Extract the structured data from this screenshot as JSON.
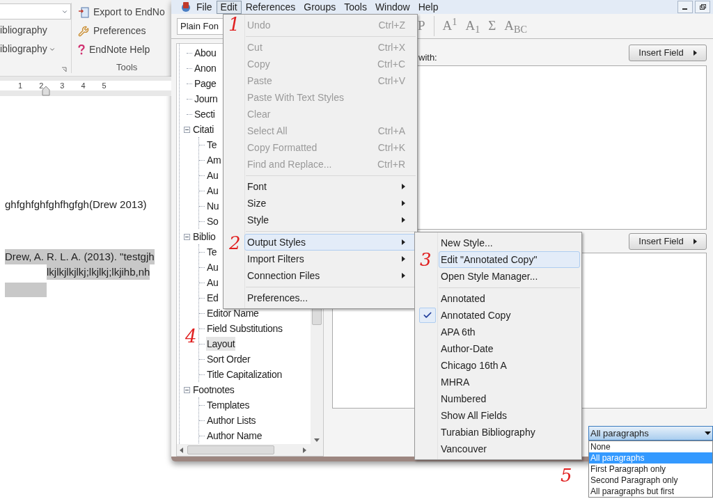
{
  "word": {
    "ribbon": {
      "left_items": [
        {
          "label": "ibliography",
          "dropdown": false
        },
        {
          "label": "ibliography",
          "dropdown": true
        }
      ],
      "tools": [
        {
          "label": "Export to EndNo"
        },
        {
          "label": "Preferences"
        },
        {
          "label": "EndNote Help"
        }
      ],
      "group_label": "Tools"
    },
    "ruler": [
      "1",
      "2",
      "3",
      "4",
      "5"
    ],
    "document": {
      "citation_text": "ghfghfghfghfhgfgh(Drew 2013)",
      "bibliography_lines": [
        "Drew, A. R. L. A. (2013). \"testgjh",
        "lkjlkjlkjlkj;lkjlkj;lkjihb,nh"
      ]
    }
  },
  "endnote": {
    "menu_bar": [
      {
        "label": "File",
        "selected": false
      },
      {
        "label": "Edit",
        "selected": true
      },
      {
        "label": "References",
        "selected": false
      },
      {
        "label": "Groups",
        "selected": false
      },
      {
        "label": "Tools",
        "selected": false
      },
      {
        "label": "Window",
        "selected": false
      },
      {
        "label": "Help",
        "selected": false
      }
    ],
    "toolbar": {
      "font_select": "Plain Fon",
      "buttons": [
        "P",
        "A$^{1}$",
        "A$_{1}$",
        "Σ",
        "A$_{BC}$"
      ]
    },
    "tree": [
      {
        "label": "Abou",
        "selected": false
      },
      {
        "label": "Anon",
        "selected": false
      },
      {
        "label": "Page",
        "selected": false
      },
      {
        "label": "Journ",
        "selected": false
      },
      {
        "label": "Secti",
        "selected": false
      },
      {
        "label": "Citati",
        "selected": false,
        "expanded": true,
        "children": [
          {
            "label": "Te",
            "selected": false
          },
          {
            "label": "Am",
            "selected": false
          },
          {
            "label": "Au",
            "selected": false
          },
          {
            "label": "Au",
            "selected": false
          },
          {
            "label": "Nu",
            "selected": false
          },
          {
            "label": "So",
            "selected": false
          }
        ]
      },
      {
        "label": "Biblio",
        "selected": false,
        "expanded": true,
        "children": [
          {
            "label": "Te",
            "selected": false
          },
          {
            "label": "Au",
            "selected": false
          },
          {
            "label": "Au",
            "selected": false
          },
          {
            "label": "Ed",
            "selected": false
          },
          {
            "label": "Editor Name",
            "selected": false
          },
          {
            "label": "Field Substitutions",
            "selected": false
          },
          {
            "label": "Layout",
            "selected": true
          },
          {
            "label": "Sort Order",
            "selected": false
          },
          {
            "label": "Title Capitalization",
            "selected": false
          }
        ]
      },
      {
        "label": "Footnotes",
        "selected": false,
        "expanded": true,
        "children": [
          {
            "label": "Templates",
            "selected": false
          },
          {
            "label": "Author Lists",
            "selected": false
          },
          {
            "label": "Author Name",
            "selected": false
          }
        ]
      }
    ],
    "editor": {
      "label": "with:",
      "insert_buttons": [
        "Insert Field",
        "Insert Field"
      ],
      "paragraph_select": {
        "value": "All paragraphs",
        "options": [
          {
            "label": "None",
            "selected": false
          },
          {
            "label": "All paragraphs",
            "selected": true
          },
          {
            "label": "First Paragraph only",
            "selected": false
          },
          {
            "label": "Second Paragraph only",
            "selected": false
          },
          {
            "label": "All paragraphs but first",
            "selected": false
          }
        ]
      }
    },
    "edit_menu": [
      {
        "kind": "item",
        "label": "Undo",
        "shortcut": "Ctrl+Z",
        "disabled": true,
        "submenu": false,
        "selected": false
      },
      {
        "kind": "separator"
      },
      {
        "kind": "item",
        "label": "Cut",
        "shortcut": "Ctrl+X",
        "disabled": true,
        "submenu": false,
        "selected": false
      },
      {
        "kind": "item",
        "label": "Copy",
        "shortcut": "Ctrl+C",
        "disabled": true,
        "submenu": false,
        "selected": false
      },
      {
        "kind": "item",
        "label": "Paste",
        "shortcut": "Ctrl+V",
        "disabled": true,
        "submenu": false,
        "selected": false
      },
      {
        "kind": "item",
        "label": "Paste With Text Styles",
        "disabled": true,
        "submenu": false,
        "selected": false
      },
      {
        "kind": "item",
        "label": "Clear",
        "disabled": true,
        "submenu": false,
        "selected": false
      },
      {
        "kind": "item",
        "label": "Select All",
        "shortcut": "Ctrl+A",
        "disabled": true,
        "submenu": false,
        "selected": false
      },
      {
        "kind": "item",
        "label": "Copy Formatted",
        "shortcut": "Ctrl+K",
        "disabled": true,
        "submenu": false,
        "selected": false
      },
      {
        "kind": "item",
        "label": "Find and Replace...",
        "shortcut": "Ctrl+R",
        "disabled": true,
        "submenu": false,
        "selected": false
      },
      {
        "kind": "separator"
      },
      {
        "kind": "item",
        "label": "Font",
        "disabled": false,
        "submenu": true,
        "selected": false
      },
      {
        "kind": "item",
        "label": "Size",
        "disabled": false,
        "submenu": true,
        "selected": false
      },
      {
        "kind": "item",
        "label": "Style",
        "disabled": false,
        "submenu": true,
        "selected": false
      },
      {
        "kind": "separator"
      },
      {
        "kind": "item",
        "label": "Output Styles",
        "disabled": false,
        "submenu": true,
        "selected": true
      },
      {
        "kind": "item",
        "label": "Import Filters",
        "disabled": false,
        "submenu": true,
        "selected": false
      },
      {
        "kind": "item",
        "label": "Connection Files",
        "disabled": false,
        "submenu": true,
        "selected": false
      },
      {
        "kind": "separator"
      },
      {
        "kind": "item",
        "label": "Preferences...",
        "disabled": false,
        "submenu": false,
        "selected": false
      }
    ],
    "styles_menu": [
      {
        "kind": "item",
        "label": "New Style...",
        "checked": false,
        "selected": false
      },
      {
        "kind": "item",
        "label": "Edit \"Annotated Copy\"",
        "checked": false,
        "selected": true
      },
      {
        "kind": "item",
        "label": "Open Style Manager...",
        "checked": false,
        "selected": false
      },
      {
        "kind": "separator"
      },
      {
        "kind": "item",
        "label": "Annotated",
        "checked": false,
        "selected": false
      },
      {
        "kind": "item",
        "label": "Annotated Copy",
        "checked": true,
        "selected": false
      },
      {
        "kind": "item",
        "label": "APA 6th",
        "checked": false,
        "selected": false
      },
      {
        "kind": "item",
        "label": "Author-Date",
        "checked": false,
        "selected": false
      },
      {
        "kind": "item",
        "label": "Chicago 16th A",
        "checked": false,
        "selected": false
      },
      {
        "kind": "item",
        "label": "MHRA",
        "checked": false,
        "selected": false
      },
      {
        "kind": "item",
        "label": "Numbered",
        "checked": false,
        "selected": false
      },
      {
        "kind": "item",
        "label": "Show All Fields",
        "checked": false,
        "selected": false
      },
      {
        "kind": "item",
        "label": "Turabian Bibliography",
        "checked": false,
        "selected": false
      },
      {
        "kind": "item",
        "label": "Vancouver",
        "checked": false,
        "selected": false
      }
    ]
  },
  "annotations": [
    "1",
    "2",
    "3",
    "4",
    "5"
  ]
}
